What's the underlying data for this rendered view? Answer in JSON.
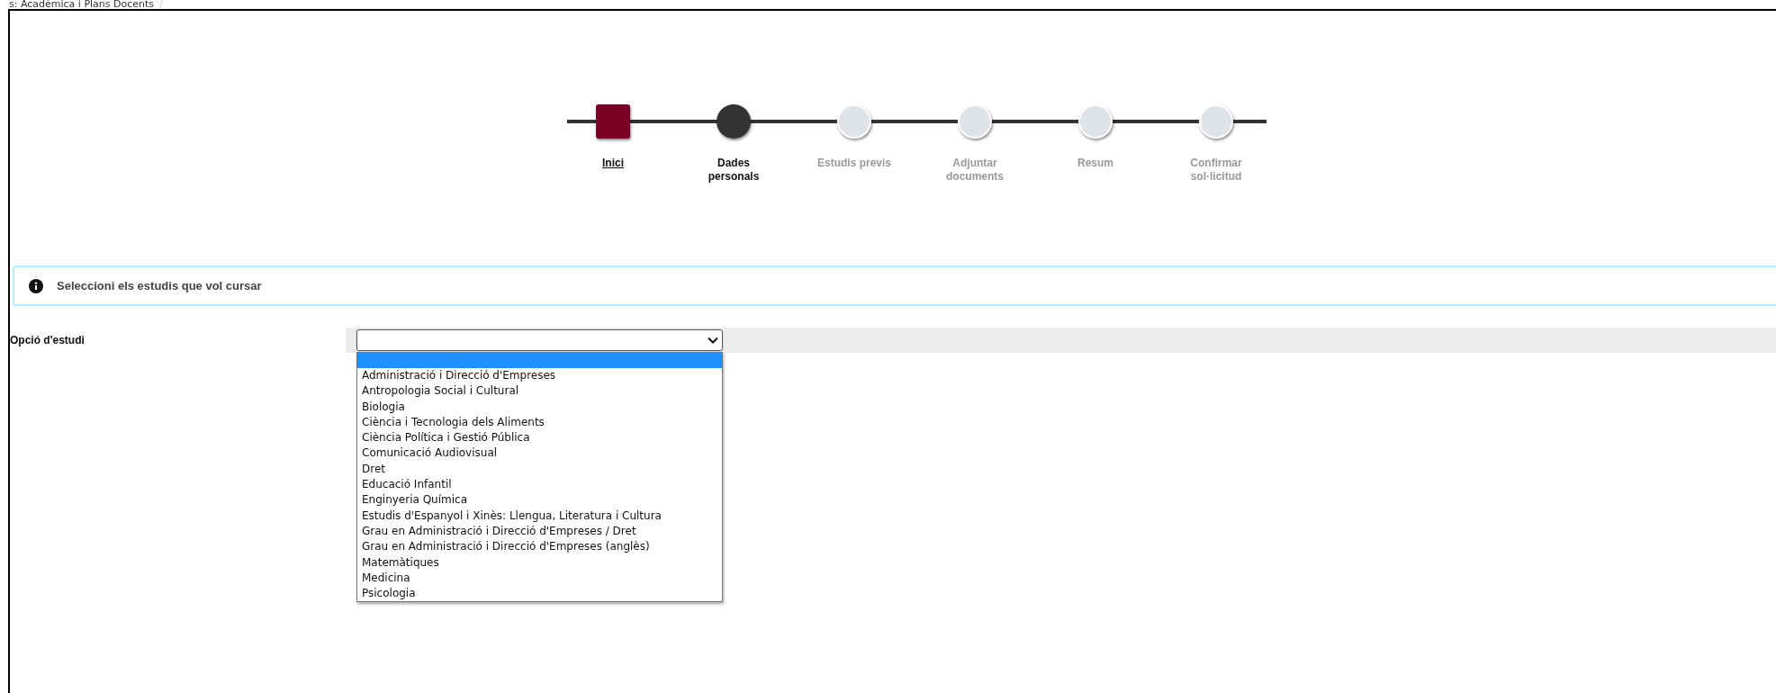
{
  "breadcrumb": {
    "text": "s: Acadèmica i Plans Docents",
    "separator": "/"
  },
  "steps": [
    {
      "label": "Inici",
      "kind": "start"
    },
    {
      "label": "Dades personals",
      "kind": "current"
    },
    {
      "label": "Estudis previs",
      "kind": "pending"
    },
    {
      "label": "Adjuntar documents",
      "kind": "pending"
    },
    {
      "label": "Resum",
      "kind": "pending"
    },
    {
      "label": "Confirmar sol·licitud",
      "kind": "pending"
    }
  ],
  "notice": {
    "message": "Seleccioni els estudis que vol cursar"
  },
  "field": {
    "label": "Opció d'estudi",
    "expanded": true,
    "blank_option_selected": true,
    "options": [
      {
        "label": "Administració i Direcció d'Empreses",
        "selected": false
      },
      {
        "label": "Antropologia Social i Cultural",
        "selected": false
      },
      {
        "label": "Biologia",
        "selected": false
      },
      {
        "label": "Ciència i Tecnologia dels Aliments",
        "selected": false
      },
      {
        "label": "Ciència Política i Gestió Pública",
        "selected": false
      },
      {
        "label": "Comunicació Audiovisual",
        "selected": false
      },
      {
        "label": "Dret",
        "selected": false
      },
      {
        "label": "Educació Infantil",
        "selected": false
      },
      {
        "label": "Enginyeria Química",
        "selected": false
      },
      {
        "label": "Estudis d'Espanyol i Xinès: Llengua, Literatura i Cultura",
        "selected": false
      },
      {
        "label": "Grau en Administració i Direcció d'Empreses / Dret",
        "selected": false
      },
      {
        "label": "Grau en Administració i Direcció d'Empreses (anglès)",
        "selected": false
      },
      {
        "label": "Matemàtiques",
        "selected": false
      },
      {
        "label": "Medicina",
        "selected": false
      },
      {
        "label": "Psicologia",
        "selected": false
      }
    ]
  }
}
